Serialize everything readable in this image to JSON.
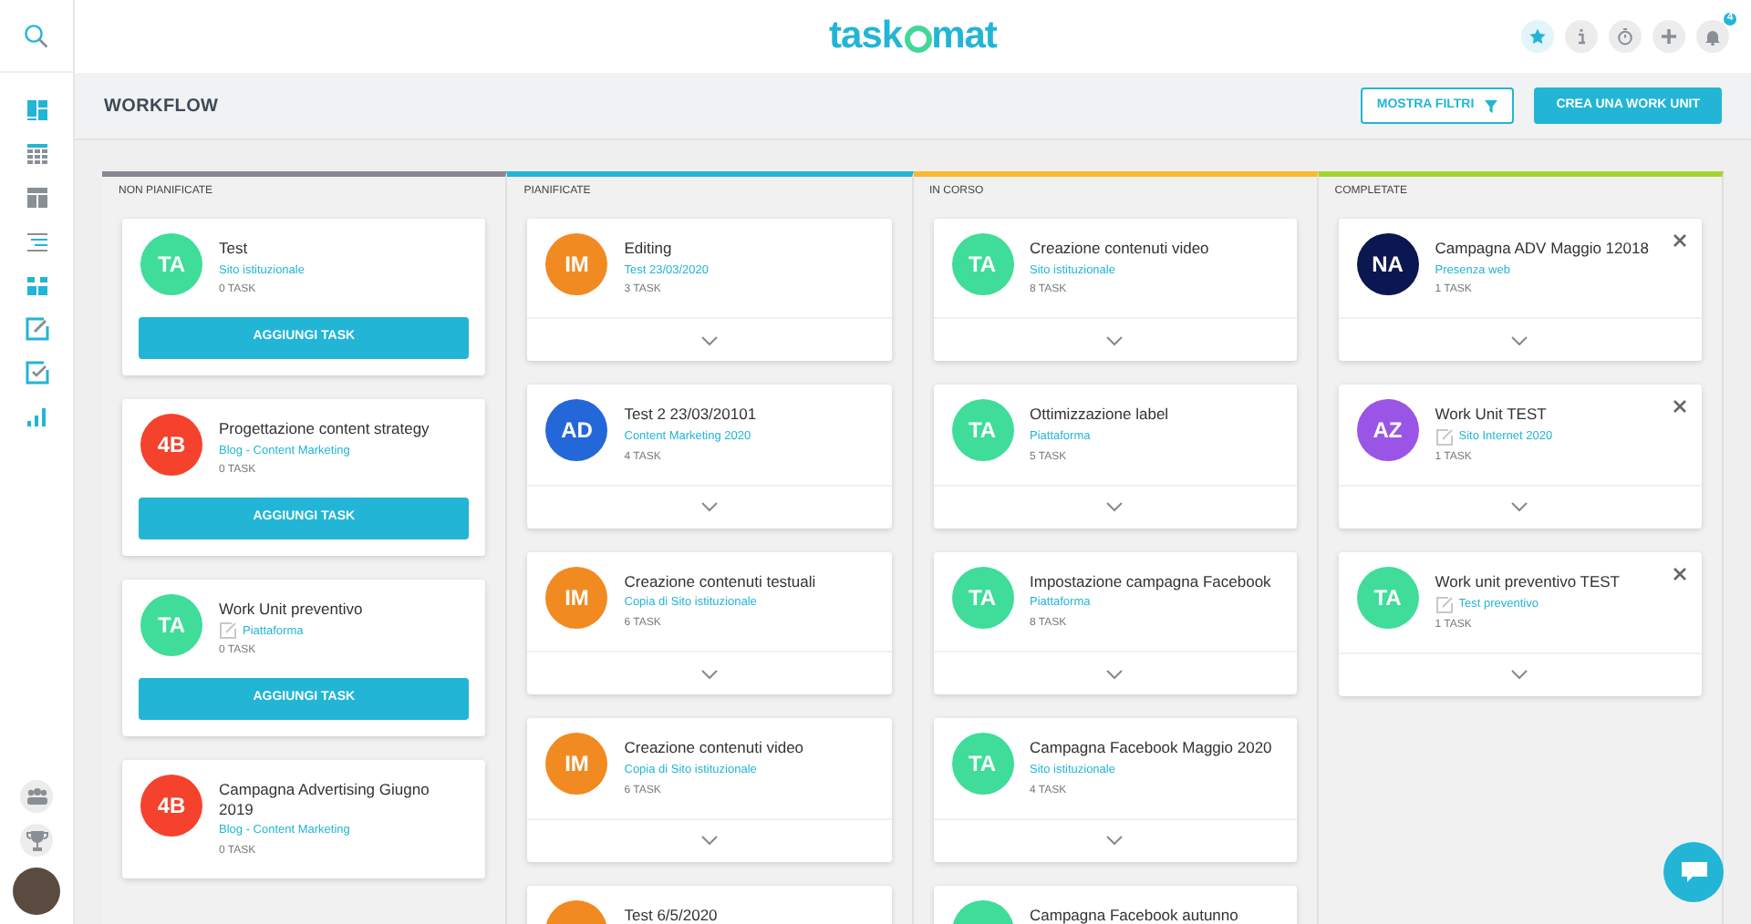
{
  "logo": {
    "left": "task",
    "right": "mat"
  },
  "header_actions": [
    {
      "kind": "star",
      "selected": true
    },
    {
      "kind": "info",
      "selected": false
    },
    {
      "kind": "timer",
      "selected": false
    },
    {
      "kind": "plus",
      "selected": false
    },
    {
      "kind": "bell",
      "selected": false,
      "badge": "4"
    }
  ],
  "sidebar": {
    "items": [
      {
        "kind": "dashboard"
      },
      {
        "kind": "calendar"
      },
      {
        "kind": "board"
      },
      {
        "kind": "list"
      },
      {
        "kind": "grid"
      },
      {
        "kind": "edit"
      },
      {
        "kind": "check"
      },
      {
        "kind": "chart"
      }
    ],
    "bottom": [
      {
        "kind": "team"
      },
      {
        "kind": "trophy"
      }
    ]
  },
  "page": {
    "title": "WORKFLOW",
    "filter_button": "MOSTRA FILTRI",
    "create_button": "CREA UNA WORK UNIT"
  },
  "columns": [
    {
      "title": "NON PIANIFICATE",
      "color": "#8a8793",
      "cards": [
        {
          "kind": "unplanned",
          "initials": "TA",
          "color": "#3fdc9a",
          "title": "Test",
          "project": "Sito istituzionale",
          "project_icon": false,
          "tasks": "0 TASK",
          "button": "AGGIUNGI TASK",
          "closable": false
        },
        {
          "kind": "unplanned",
          "initials": "4B",
          "color": "#f4422c",
          "title": "Progettazione content strategy",
          "project": "Blog - Content Marketing",
          "project_icon": false,
          "tasks": "0 TASK",
          "button": "AGGIUNGI TASK",
          "closable": false
        },
        {
          "kind": "unplanned",
          "initials": "TA",
          "color": "#3fdc9a",
          "title": "Work Unit preventivo",
          "project": "Piattaforma",
          "project_icon": true,
          "tasks": "0 TASK",
          "button": "AGGIUNGI TASK",
          "closable": false
        },
        {
          "kind": "partial",
          "initials": "4B",
          "color": "#f4422c",
          "title": "Campagna Advertising Giugno 2019",
          "project": "Blog - Content Marketing",
          "project_icon": false,
          "tasks": "0 TASK",
          "closable": false
        }
      ]
    },
    {
      "title": "PIANIFICATE",
      "color": "#22b5d6",
      "cards": [
        {
          "kind": "planned",
          "initials": "IM",
          "color": "#f28a22",
          "title": "Editing",
          "project": "Test 23/03/2020",
          "project_icon": false,
          "tasks": "3 TASK",
          "closable": false
        },
        {
          "kind": "planned",
          "initials": "AD",
          "color": "#2467d8",
          "title": "Test 2 23/03/20101",
          "project": "Content Marketing 2020",
          "project_icon": false,
          "tasks": "4 TASK",
          "closable": false
        },
        {
          "kind": "planned",
          "initials": "IM",
          "color": "#f28a22",
          "title": "Creazione contenuti testuali",
          "project": "Copia di Sito istituzionale",
          "project_icon": false,
          "tasks": "6 TASK",
          "closable": false
        },
        {
          "kind": "planned",
          "initials": "IM",
          "color": "#f28a22",
          "title": "Creazione contenuti video",
          "project": "Copia di Sito istituzionale",
          "project_icon": false,
          "tasks": "6 TASK",
          "closable": false
        },
        {
          "kind": "stub",
          "color": "#f28a22",
          "title": "Test 6/5/2020"
        }
      ]
    },
    {
      "title": "IN CORSO",
      "color": "#fbb92e",
      "cards": [
        {
          "kind": "planned",
          "initials": "TA",
          "color": "#3fdc9a",
          "title": "Creazione contenuti video",
          "project": "Sito istituzionale",
          "project_icon": false,
          "tasks": "8 TASK",
          "closable": false
        },
        {
          "kind": "planned",
          "initials": "TA",
          "color": "#3fdc9a",
          "title": "Ottimizzazione label",
          "project": "Piattaforma",
          "project_icon": false,
          "tasks": "5 TASK",
          "closable": false
        },
        {
          "kind": "planned",
          "initials": "TA",
          "color": "#3fdc9a",
          "title": "Impostazione campagna Facebook",
          "project": "Piattaforma",
          "project_icon": false,
          "tasks": "8 TASK",
          "closable": false
        },
        {
          "kind": "planned",
          "initials": "TA",
          "color": "#3fdc9a",
          "title": "Campagna Facebook Maggio 2020",
          "project": "Sito istituzionale",
          "project_icon": false,
          "tasks": "4 TASK",
          "closable": false
        },
        {
          "kind": "stub",
          "color": "#3fdc9a",
          "title": "Campagna Facebook autunno"
        }
      ]
    },
    {
      "title": "COMPLETATE",
      "color": "#a3d52c",
      "cards": [
        {
          "kind": "planned",
          "initials": "NA",
          "color": "#0b1750",
          "title": "Campagna ADV Maggio 12018",
          "project": "Presenza web",
          "project_icon": false,
          "tasks": "1 TASK",
          "closable": true
        },
        {
          "kind": "planned",
          "initials": "AZ",
          "color": "#9a55e6",
          "title": "Work Unit TEST",
          "project": "Sito Internet 2020",
          "project_icon": true,
          "tasks": "1 TASK",
          "closable": true
        },
        {
          "kind": "planned",
          "initials": "TA",
          "color": "#3fdc9a",
          "title": "Work unit preventivo TEST",
          "project": "Test preventivo",
          "project_icon": true,
          "tasks": "1 TASK",
          "closable": true
        }
      ]
    }
  ]
}
